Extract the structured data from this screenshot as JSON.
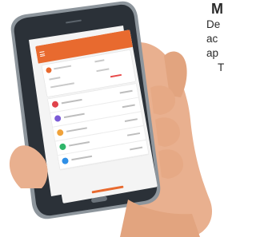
{
  "side_text": {
    "heading": "M",
    "lines": [
      "De",
      "ac",
      "ap",
      "T"
    ]
  },
  "screen": {
    "accent_color": "#e86a2f",
    "rows": [
      {
        "color": "#e0434b"
      },
      {
        "color": "#7b5bd6"
      },
      {
        "color": "#f0a23a"
      },
      {
        "color": "#2fb66a"
      },
      {
        "color": "#2f8fe6"
      }
    ]
  },
  "colors": {
    "skin": "#e9b08f",
    "skin_shadow": "#c98a6b",
    "phone_body": "#2b3138",
    "phone_edge": "#8d959c"
  }
}
